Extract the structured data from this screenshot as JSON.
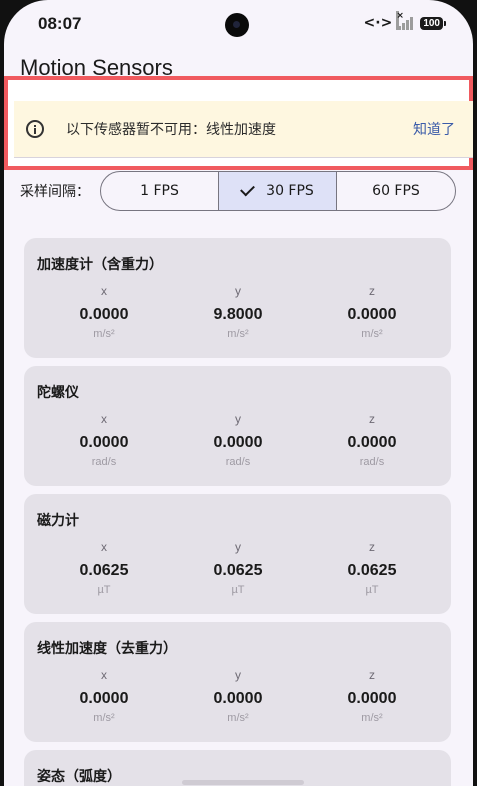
{
  "status_bar": {
    "time": "08:07",
    "data_icon": "<·>",
    "battery": "100"
  },
  "page": {
    "title": "Motion Sensors"
  },
  "banner": {
    "icon": "info-icon",
    "message": "以下传感器暂不可用：线性加速度",
    "action": "知道了",
    "background_color": "#fef7e0",
    "action_color": "#3a5ba9",
    "highlight_color": "#f05a5f"
  },
  "sampling": {
    "label": "采样间隔：",
    "options": [
      "1 FPS",
      "30 FPS",
      "60 FPS"
    ],
    "selected": "30 FPS"
  },
  "axes": [
    "x",
    "y",
    "z"
  ],
  "cards": [
    {
      "title": "加速度计（含重力）",
      "values": [
        "0.0000",
        "9.8000",
        "0.0000"
      ],
      "unit": "m/s²"
    },
    {
      "title": "陀螺仪",
      "values": [
        "0.0000",
        "0.0000",
        "0.0000"
      ],
      "unit": "rad/s"
    },
    {
      "title": "磁力计",
      "values": [
        "0.0625",
        "0.0625",
        "0.0625"
      ],
      "unit": "µT"
    },
    {
      "title": "线性加速度（去重力）",
      "values": [
        "0.0000",
        "0.0000",
        "0.0000"
      ],
      "unit": "m/s²"
    },
    {
      "title": "姿态（弧度）"
    }
  ]
}
